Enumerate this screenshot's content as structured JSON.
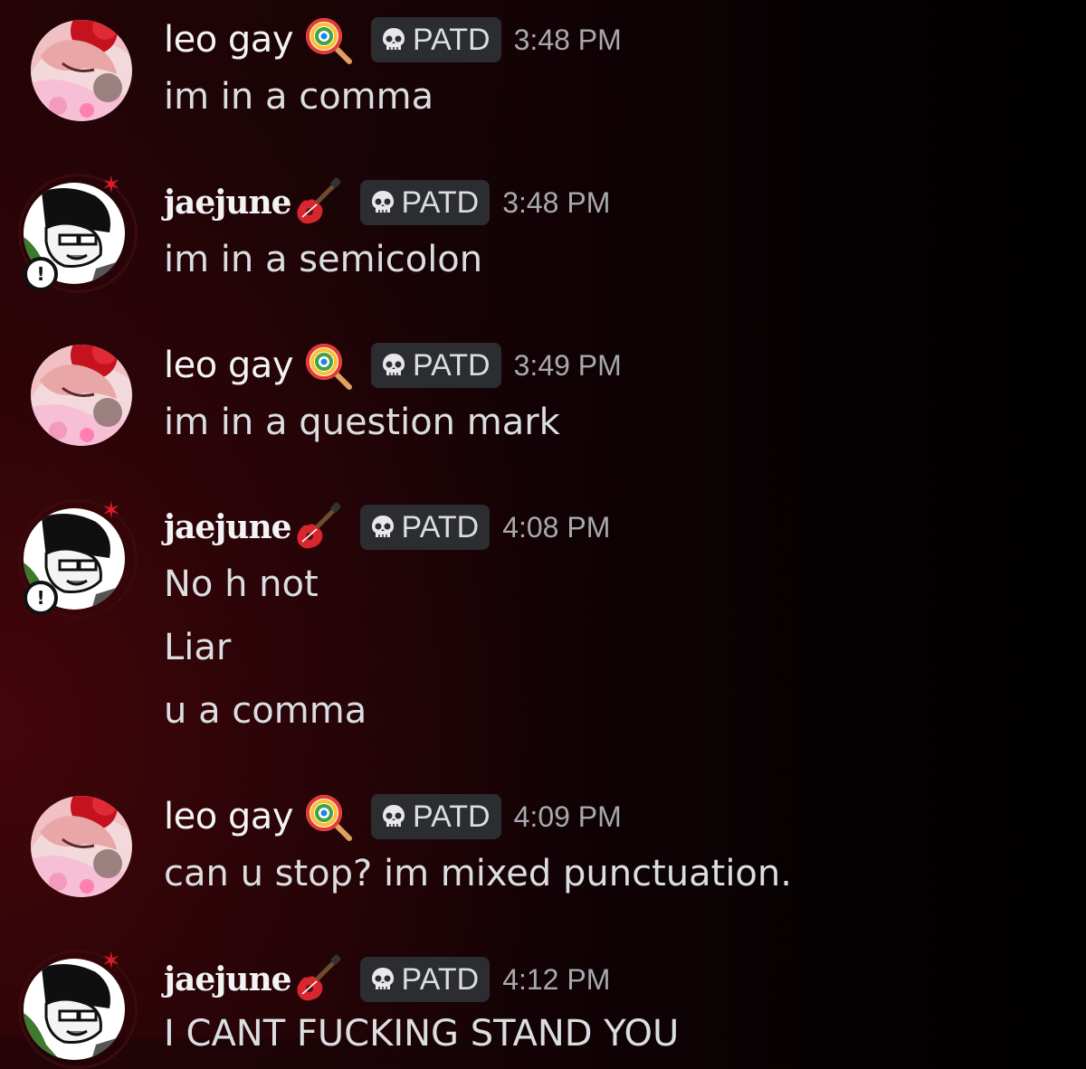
{
  "messages": [
    {
      "author": "leo gay",
      "author_emoji": "lollipop-emoji",
      "tag": "PATD",
      "tag_icon": "skull-icon",
      "time": "3:48 PM",
      "lines": [
        "im in a comma"
      ]
    },
    {
      "author": "jaejune",
      "author_emoji": "guitar-emoji",
      "tag": "PATD",
      "tag_icon": "skull-icon",
      "time": "3:48 PM",
      "lines": [
        "im in a semicolon"
      ]
    },
    {
      "author": "leo gay",
      "author_emoji": "lollipop-emoji",
      "tag": "PATD",
      "tag_icon": "skull-icon",
      "time": "3:49 PM",
      "lines": [
        "im in a question mark"
      ]
    },
    {
      "author": "jaejune",
      "author_emoji": "guitar-emoji",
      "tag": "PATD",
      "tag_icon": "skull-icon",
      "time": "4:08 PM",
      "lines": [
        "No h not",
        "Liar",
        "u a comma"
      ]
    },
    {
      "author": "leo gay",
      "author_emoji": "lollipop-emoji",
      "tag": "PATD",
      "tag_icon": "skull-icon",
      "time": "4:09 PM",
      "lines": [
        "can u stop? im mixed punctuation."
      ]
    },
    {
      "author": "jaejune",
      "author_emoji": "guitar-emoji",
      "tag": "PATD",
      "tag_icon": "skull-icon",
      "time": "4:12 PM",
      "lines": [
        "I CANT FUCKING STAND YOU"
      ]
    }
  ],
  "colors": {
    "username": "#f2f3f5",
    "message_text": "#dbdee1",
    "timestamp": "#a7a9b0",
    "tag_background": "#2b2d31",
    "background_accent": "#46060a"
  }
}
